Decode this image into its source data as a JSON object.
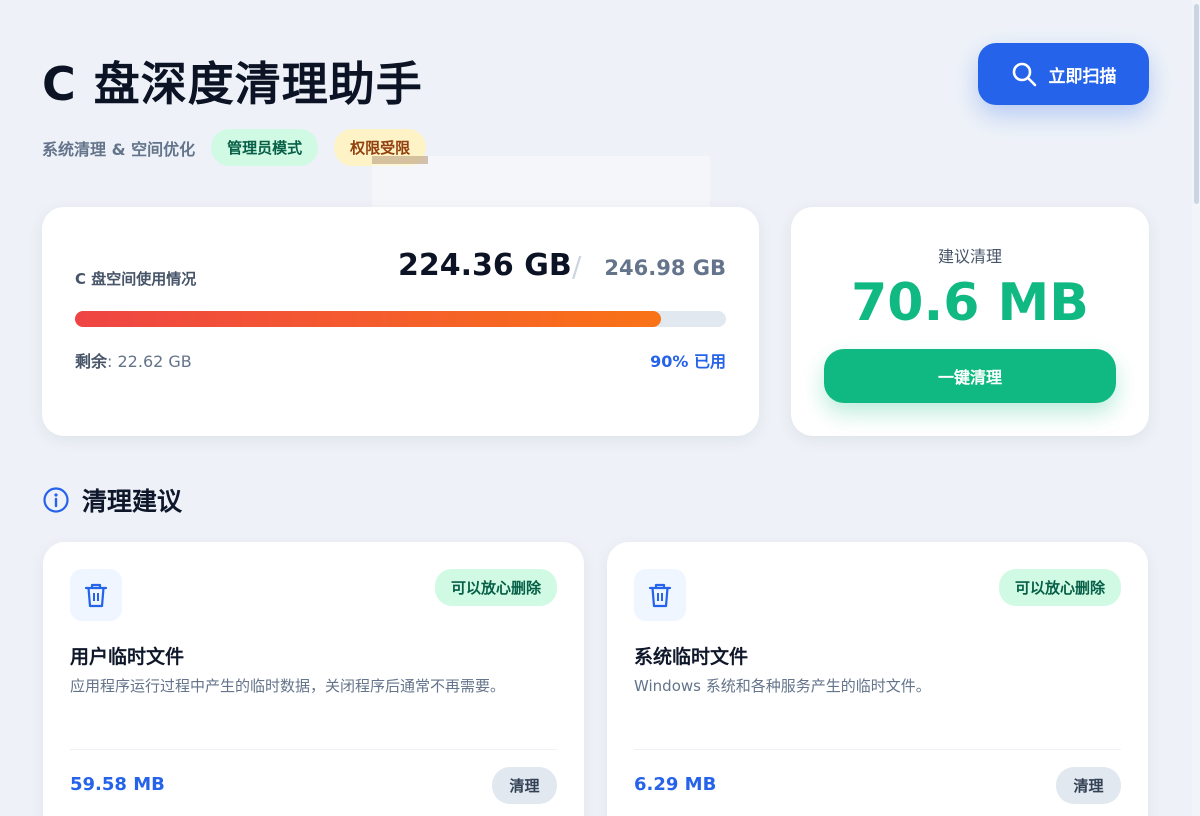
{
  "header": {
    "title": "C 盘深度清理助手",
    "subtitle": "系统清理 & 空间优化",
    "badge_admin": "管理员模式",
    "badge_limited": "权限受限",
    "scan_button": "立即扫描"
  },
  "disk": {
    "label": "C 盘空间使用情况",
    "used": "224.36 GB",
    "separator": "/",
    "total": "246.98 GB",
    "remaining_label": "剩余",
    "remaining_value": ": 22.62 GB",
    "used_percent_text": "90% 已用",
    "used_fraction": 0.9
  },
  "suggestion": {
    "label": "建议清理",
    "value": "70.6 MB",
    "clean_all_button": "一键清理"
  },
  "section": {
    "title": "清理建议"
  },
  "items": [
    {
      "badge": "可以放心删除",
      "title": "用户临时文件",
      "description": "应用程序运行过程中产生的临时数据，关闭程序后通常不再需要。",
      "size": "59.58 MB",
      "clean_button": "清理"
    },
    {
      "badge": "可以放心删除",
      "title": "系统临时文件",
      "description": "Windows 系统和各种服务产生的临时文件。",
      "size": "6.29 MB",
      "clean_button": "清理"
    }
  ],
  "colors": {
    "accent": "#2563eb",
    "success": "#10b981",
    "progress_start": "#ef4444",
    "progress_end": "#f97316"
  }
}
